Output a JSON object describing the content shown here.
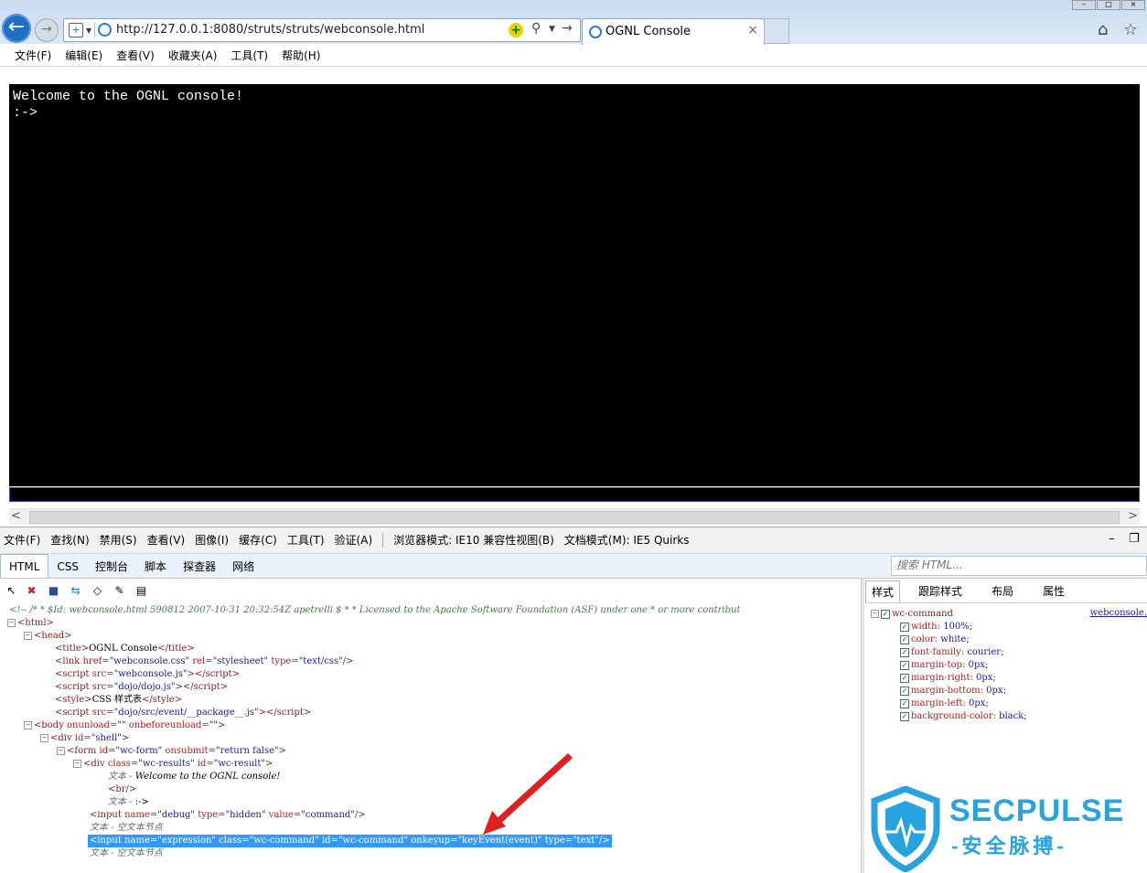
{
  "browser": {
    "url": "http://127.0.0.1:8080/struts/struts/webconsole.html",
    "tab_title": "OGNL Console",
    "menu": [
      "文件(F)",
      "编辑(E)",
      "查看(V)",
      "收藏夹(A)",
      "工具(T)",
      "帮助(H)"
    ]
  },
  "console": {
    "lines": [
      "Welcome to the OGNL console!",
      ":->"
    ]
  },
  "devtools": {
    "menu": [
      "文件(F)",
      "查找(N)",
      "禁用(S)",
      "查看(V)",
      "图像(I)",
      "缓存(C)",
      "工具(T)",
      "验证(A)"
    ],
    "browser_mode": "浏览器模式: IE10 兼容性视图(B)",
    "doc_mode": "文档模式(M): IE5 Quirks",
    "tabs": [
      "HTML",
      "CSS",
      "控制台",
      "脚本",
      "探查器",
      "网络"
    ],
    "search_placeholder": "搜索 HTML...",
    "dom": {
      "comment": "<!-- /* * $Id: webconsole.html 590812 2007-10-31 20:32:54Z apetrelli $ * * Licensed to the Apache Software Foundation (ASF) under one * or more contribut",
      "text_label": "文本",
      "empty_text_label": "文本 - 空文本节点",
      "welcome_text": "Welcome to the OGNL console!",
      "prompt_text": ":->",
      "title_text": "OGNL Console",
      "style_text": "CSS 样式表"
    },
    "style_tabs": [
      "样式",
      "跟踪样式",
      "布局",
      "属性"
    ],
    "style_rule": {
      "selector": "wc-command",
      "source": "webconsole.",
      "props": [
        {
          "name": "width",
          "value": "100%;"
        },
        {
          "name": "color",
          "value": "white;"
        },
        {
          "name": "font-family",
          "value": "courier;"
        },
        {
          "name": "margin-top",
          "value": "0px;"
        },
        {
          "name": "margin-right",
          "value": "0px;"
        },
        {
          "name": "margin-bottom",
          "value": "0px;"
        },
        {
          "name": "margin-left",
          "value": "0px;"
        },
        {
          "name": "background-color",
          "value": "black;"
        }
      ]
    }
  },
  "watermark": {
    "title": "SECPULSE",
    "subtitle": "-安全脉搏-"
  },
  "colors": {
    "console_bg": "#000000",
    "console_fg": "#ffffff",
    "selection": "#3399ff",
    "arrow": "#e02020",
    "watermark": "#27a3e0"
  }
}
